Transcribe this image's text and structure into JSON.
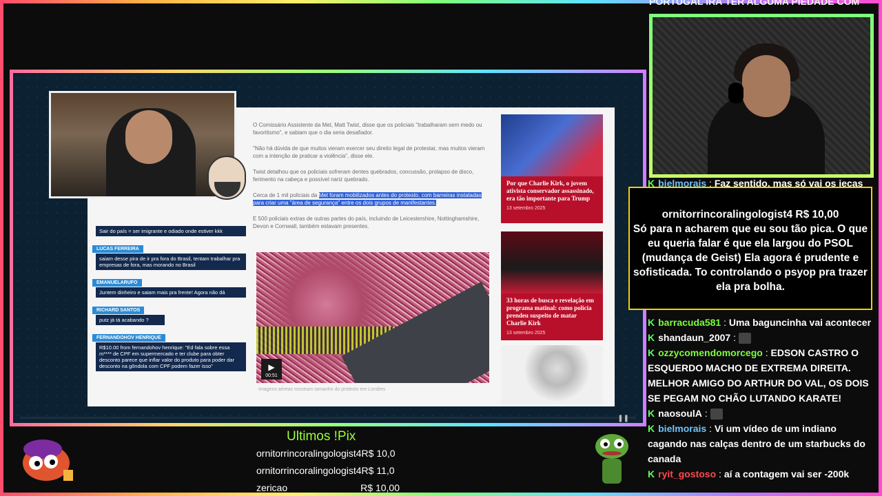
{
  "ticker": "PORTUGAL IRÁ TER ALGUMA PIEDADE COM",
  "article": {
    "paragraphs": [
      "O Comissário Assistente da Met, Matt Twist, disse que os policiais \"trabalharam sem medo ou favoritismo\", e sabiam que o dia seria desafiador.",
      "\"Não há dúvida de que muitos vieram exercer seu direito legal de protestar, mas muitos vieram com a intenção de praticar a violência\", disse ele.",
      "Twist detalhou que os policiais sofreram dentes quebrados, concussão, prolapso de disco, ferimento na cabeça e possível nariz quebrado."
    ],
    "highlight_pre": "Cerca de 1 mil policiais da ",
    "highlight_text": "Met foram mobilizados antes do protesto, com barreiras instaladas para criar uma \"área de segurança\" entre os dois grupos de manifestantes.",
    "paragraph_last": "E 500 policiais extras de outras partes do país, incluindo de Leicestershire, Nottinghamshire, Devon e Cornwall, também estavam presentes.",
    "video_time": "00:51",
    "caption": "Imagens aéreas mostram tamanho do protesto em Londres",
    "side_cards": [
      {
        "title": "Por que Charlie Kirk, o jovem ativista conservador assassinado, era tão importante para Trump",
        "date": "13 setembro 2025"
      },
      {
        "title": "33 horas de busca e revelação em programa matinal: como polícia prendeu suspeito de matar Charlie Kirk",
        "date": "13 setembro 2025"
      }
    ]
  },
  "overlay_chat": [
    {
      "name": "",
      "text": "Sair do país = ser imigrante e odiado onde estiver kkk"
    },
    {
      "name": "LUCAS FERREIRA",
      "text": "saiam desse pira de ir pra fora do Brasil, tentam trabalhar pra empresas de fora, mas morando no Brasil"
    },
    {
      "name": "EMANUELARUFO",
      "text": "Juntem dinheiro e saiam mais pra frente! Agora não dá"
    },
    {
      "name": "RICHARD SANTOS",
      "text": "putz já tá acabando ?"
    },
    {
      "name": "FERNANDOHOV HENRIQUE",
      "text": "R$10.00 from fernandohov henrique: \"Ed fala sobre essa m**** de CPF em supermercado e ter clube para obter desconto parece que inflar valor do produto para poder dar desconto na gôndola com CPF podem fazer isso\""
    }
  ],
  "highlight_box": {
    "header": "ornitorrincoralingologist4 R$ 10,00",
    "text": "Só para n acharem que eu sou tão pica. O que eu queria falar é que ela largou do PSOL (mudança de Geist) Ela agora é prudente e sofisticada. To controlando o psyop pra trazer ela pra bolha."
  },
  "chat": [
    {
      "user": "bielmorais",
      "color": "#6fc3ff",
      "text": "Faz sentido, mas só vai os jecas"
    },
    {
      "user": "barracuda581",
      "color": "#7bff3c",
      "text": "Uma baguncinha vai acontecer"
    },
    {
      "user": "shandaun_2007",
      "color": "#ffffff",
      "text": ""
    },
    {
      "user": "ozzycomendomorcego",
      "color": "#7bff3c",
      "text": "EDSON CASTRO O ESQUERDO MACHO DE EXTREMA DIREITA. MELHOR AMIGO DO ARTHUR DO VAL, OS DOIS SE PEGAM NO CHÃO LUTANDO KARATE!"
    },
    {
      "user": "naosoulA",
      "color": "#ffffff",
      "text": ""
    },
    {
      "user": "bielmorais",
      "color": "#6fc3ff",
      "text": "Vi um vídeo de um indiano cagando nas calças dentro de um starbucks do canada"
    },
    {
      "user": "ryit_gostoso",
      "color": "#ff4a4a",
      "text": "aí a contagem vai ser -200k"
    }
  ],
  "pix": {
    "title": "Ultimos !Pix",
    "rows": [
      {
        "name": "ornitorrincoralingologist4",
        "value": "R$ 10,0"
      },
      {
        "name": "ornitorrincoralingologist4",
        "value": "R$ 11,0"
      },
      {
        "name": "zericao",
        "value": "R$ 10,00"
      }
    ]
  }
}
